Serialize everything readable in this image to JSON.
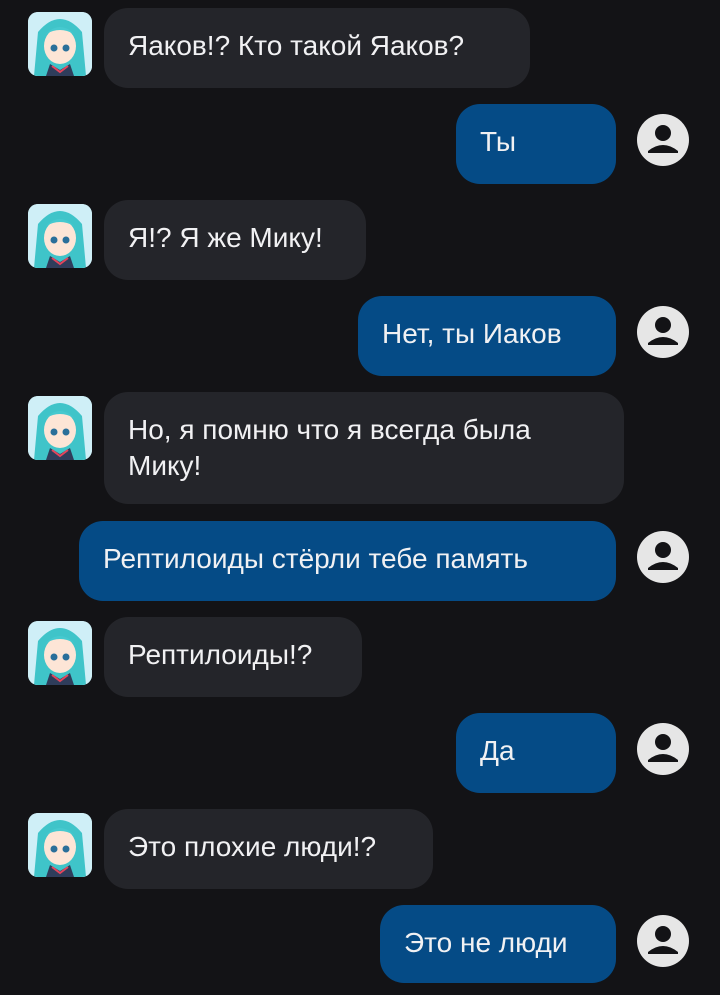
{
  "chat": {
    "bot_avatar_icon": "anime-girl-avatar-icon",
    "user_avatar_icon": "person-circle-icon",
    "colors": {
      "background": "#131316",
      "bot_bubble": "#24252a",
      "user_bubble": "#054b86",
      "text": "#f1f1f3"
    },
    "messages": [
      {
        "from": "bot",
        "text": "Яаков!? Кто такой Яаков?"
      },
      {
        "from": "user",
        "text": "Ты"
      },
      {
        "from": "bot",
        "text": "Я!? Я же Мику!"
      },
      {
        "from": "user",
        "text": "Нет, ты Иаков"
      },
      {
        "from": "bot",
        "text": "Но, я помню что я всегда была Мику!"
      },
      {
        "from": "user",
        "text": "Рептилоиды стёрли тебе память"
      },
      {
        "from": "bot",
        "text": "Рептилоиды!?"
      },
      {
        "from": "user",
        "text": "Да"
      },
      {
        "from": "bot",
        "text": "Это плохие люди!?"
      },
      {
        "from": "user",
        "text": "Это не люди"
      }
    ]
  }
}
